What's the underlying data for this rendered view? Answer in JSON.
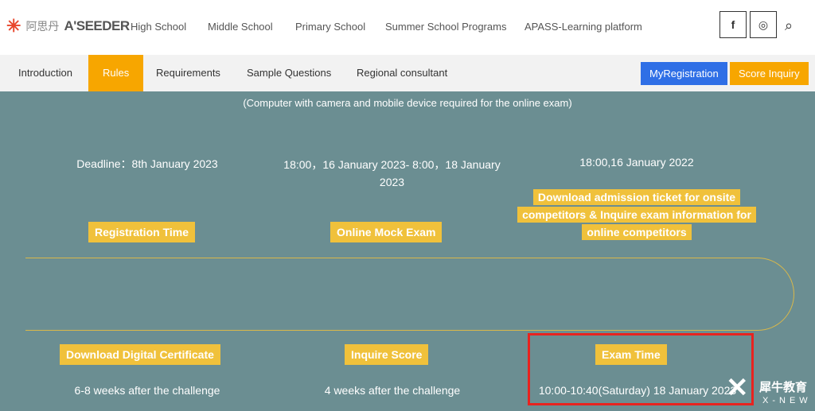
{
  "header": {
    "logo_cn": "阿思丹",
    "logo_en": "A'SEEDER",
    "nav": [
      "High School",
      "Middle School",
      "Primary School",
      "Summer School Programs",
      "APASS-Learning platform"
    ],
    "social": {
      "facebook": "f",
      "instagram": "◎"
    }
  },
  "tabs": [
    "Introduction",
    "Rules",
    "Requirements",
    "Sample Questions",
    "Regional consultant"
  ],
  "active_tab": "Rules",
  "buttons": {
    "registration": "MyRegistration",
    "score": "Score Inquiry"
  },
  "colors": {
    "accent": "#f7a600",
    "blue": "#2f6fe6",
    "teal": "#6b8e92",
    "label": "#f0c13b",
    "highlight": "#e8231f"
  },
  "note": "(Computer with camera and mobile device required for the online exam)",
  "timeline_top": [
    {
      "date": "Deadline：8th January 2023",
      "label": "Registration Time"
    },
    {
      "date": "18:00，16 January  2023- 8:00，18 January 2023",
      "label": "Online Mock Exam"
    },
    {
      "date": "18:00,16 January 2022",
      "label": "Download admission ticket for onsite competitors & Inquire exam information for online competitors"
    }
  ],
  "timeline_bottom": [
    {
      "label": "Download Digital Certificate",
      "date": "6-8 weeks after the challenge"
    },
    {
      "label": "Inquire Score",
      "date": "4 weeks after the challenge"
    },
    {
      "label": "Exam Time",
      "date": "10:00-10:40(Saturday) 18 January 2023"
    }
  ],
  "watermark": {
    "cn": "犀牛教育",
    "en": "X-NEW"
  }
}
